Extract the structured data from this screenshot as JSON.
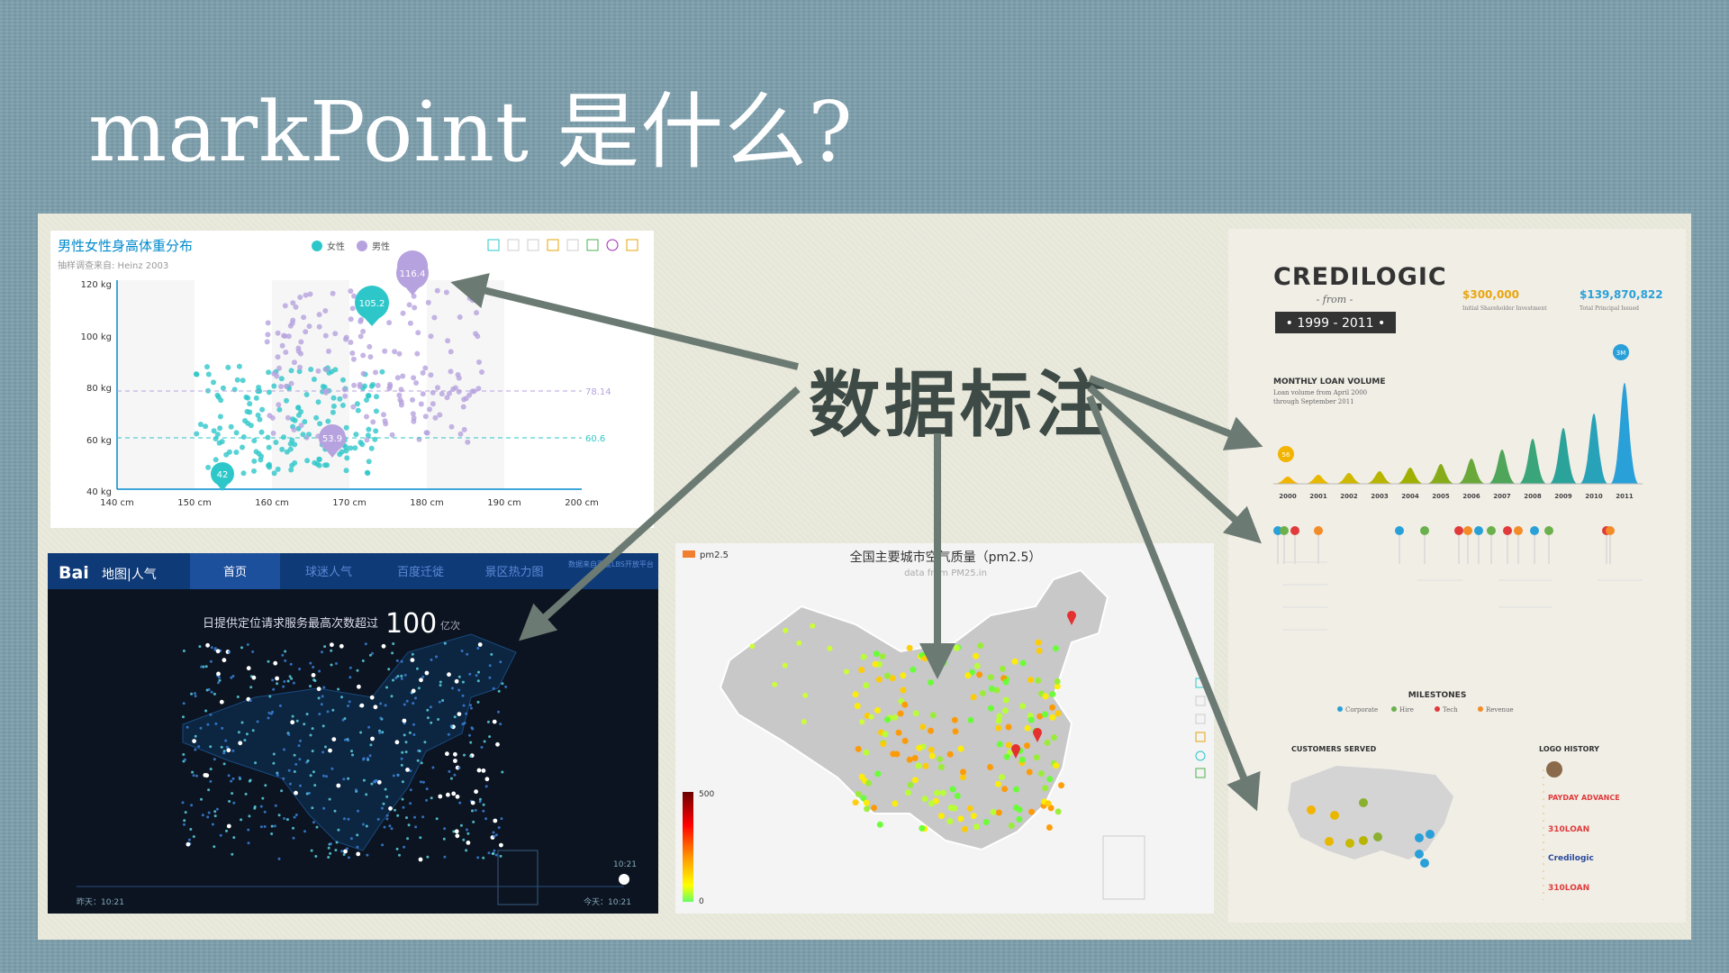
{
  "slide": {
    "title": "markPoint 是什么?",
    "center_label": "数据标注"
  },
  "scatter": {
    "title": "男性女性身高体重分布",
    "subtitle": "抽样调查来自: Heinz  2003",
    "legend": [
      "女性",
      "男性"
    ],
    "y_ticks": [
      "120 kg",
      "100 kg",
      "80 kg",
      "60 kg",
      "40 kg"
    ],
    "x_ticks": [
      "140 cm",
      "150 cm",
      "160 cm",
      "170 cm",
      "180 cm",
      "190 cm",
      "200 cm"
    ],
    "mark_points": [
      "116.4",
      "105.2",
      "53.9",
      "42"
    ],
    "mark_lines": [
      "78.14",
      "60.6"
    ],
    "colors": {
      "female": "#2ec7c9",
      "male": "#b6a2de",
      "title": "#008acd"
    }
  },
  "baidu": {
    "logo": "Bai",
    "logo_suffix": "地图|人气",
    "tabs": [
      "首页",
      "球迷人气",
      "百度迁徙",
      "景区热力图"
    ],
    "headline": "日提供定位请求服务最高次数超过",
    "big_number": "100",
    "unit": "亿次",
    "top_right": "数据来自百度LBS开放平台",
    "time_left": "昨天：10:21",
    "time_right": "今天：10:21",
    "marker_time": "10:21"
  },
  "air": {
    "title": "全国主要城市空气质量（pm2.5）",
    "subtitle": "data from PM25.in",
    "legend": "pm2.5",
    "range_max": "500",
    "range_min": "0"
  },
  "credilogic": {
    "logo": "CREDILOGIC",
    "from": "- from -",
    "years": "• 1999 - 2011 •",
    "stat1_value": "$300,000",
    "stat1_label": "Initial Shareholder Investment",
    "stat2_value": "$139,870,822",
    "stat2_label": "Total Principal Issued",
    "volume_title": "MONTHLY LOAN VOLUME",
    "volume_sub1": "Loan volume from April 2000",
    "volume_sub2": "through September 2011",
    "peak_badge": "3M",
    "first_badge": "56",
    "timeline_years": [
      "2000",
      "2001",
      "2002",
      "2003",
      "2004",
      "2005",
      "2006",
      "2007",
      "2008",
      "2009",
      "2010",
      "2011"
    ],
    "milestones_title": "MILESTONES",
    "milestone_legend": [
      "Corporate",
      "Hire",
      "Tech",
      "Revenue"
    ],
    "customers_title": "CUSTOMERS SERVED",
    "logo_history_title": "LOGO HISTORY",
    "logo_history": [
      "PAYDAY ADVANCE",
      "310LOAN",
      "Credilogic",
      "310LOAN"
    ]
  }
}
